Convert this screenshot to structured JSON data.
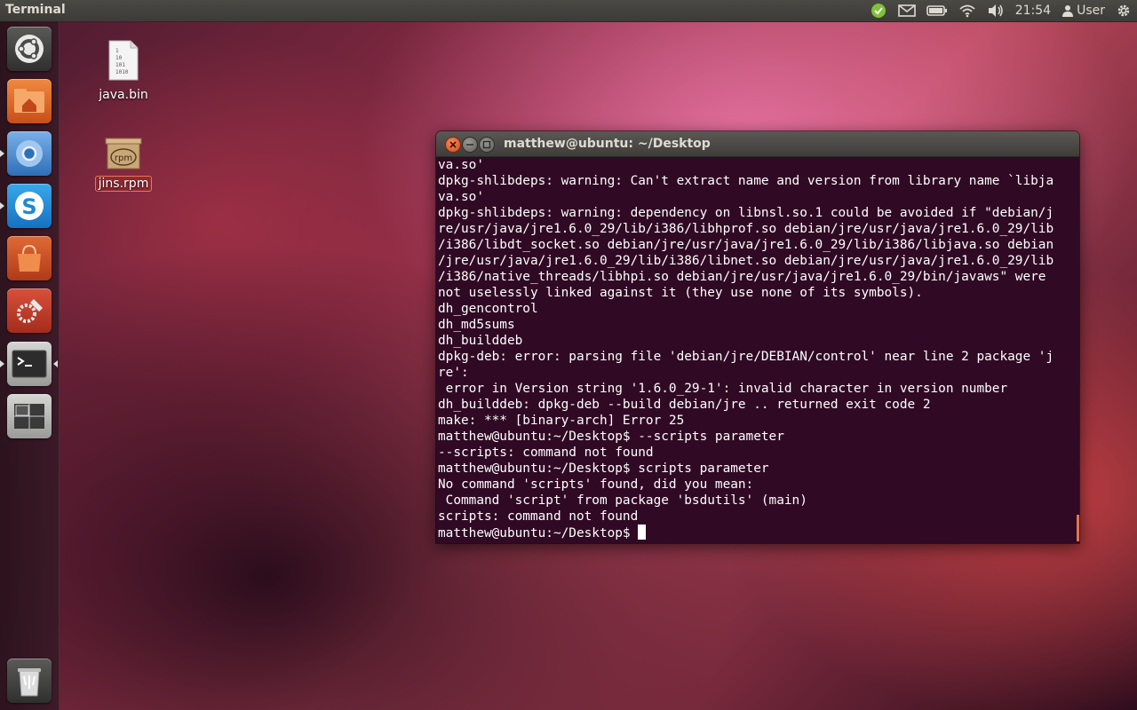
{
  "panel": {
    "app_title": "Terminal",
    "clock": "21:54",
    "user": "User",
    "indicators": [
      "mail-icon",
      "battery-icon",
      "wifi-icon",
      "volume-icon",
      "gear-icon"
    ]
  },
  "launcher": {
    "items": [
      "dash-home",
      "home-folder",
      "chromium",
      "skype",
      "software-center",
      "system-settings",
      "terminal",
      "workspace-switcher",
      "trash"
    ]
  },
  "desktop": {
    "icons": [
      {
        "label": "java.bin"
      },
      {
        "label": "jins.rpm"
      }
    ]
  },
  "terminal": {
    "title": "matthew@ubuntu: ~/Desktop",
    "lines": [
      "va.so'",
      "dpkg-shlibdeps: warning: Can't extract name and version from library name `libja",
      "va.so'",
      "dpkg-shlibdeps: warning: dependency on libnsl.so.1 could be avoided if \"debian/j",
      "re/usr/java/jre1.6.0_29/lib/i386/libhprof.so debian/jre/usr/java/jre1.6.0_29/lib",
      "/i386/libdt_socket.so debian/jre/usr/java/jre1.6.0_29/lib/i386/libjava.so debian",
      "/jre/usr/java/jre1.6.0_29/lib/i386/libnet.so debian/jre/usr/java/jre1.6.0_29/lib",
      "/i386/native_threads/libhpi.so debian/jre/usr/java/jre1.6.0_29/bin/javaws\" were",
      "not uselessly linked against it (they use none of its symbols).",
      "dh_gencontrol",
      "dh_md5sums",
      "dh_builddeb",
      "dpkg-deb: error: parsing file 'debian/jre/DEBIAN/control' near line 2 package 'j",
      "re':",
      " error in Version string '1.6.0_29-1': invalid character in version number",
      "dh_builddeb: dpkg-deb --build debian/jre .. returned exit code 2",
      "make: *** [binary-arch] Error 25",
      "matthew@ubuntu:~/Desktop$ --scripts parameter",
      "--scripts: command not found",
      "matthew@ubuntu:~/Desktop$ scripts parameter",
      "No command 'scripts' found, did you mean:",
      " Command 'script' from package 'bsdutils' (main)",
      "scripts: command not found"
    ],
    "prompt": "matthew@ubuntu:~/Desktop$ "
  },
  "colors": {
    "terminal_bg": "#300a24",
    "panel_bg": "#3c3b37",
    "close_button": "#e25b2c"
  }
}
